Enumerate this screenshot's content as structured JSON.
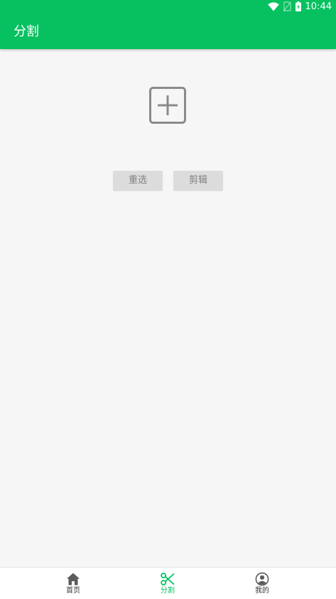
{
  "status_bar": {
    "time": "10:44",
    "icons": [
      "wifi-icon",
      "no-sim-icon",
      "battery-charging-icon"
    ]
  },
  "app_bar": {
    "title": "分割"
  },
  "main": {
    "add_image_icon": "add-square-icon",
    "reselect_label": "重选",
    "crop_label": "剪辑"
  },
  "bottom_nav": {
    "items": [
      {
        "label": "首页",
        "icon": "home-icon",
        "active": false
      },
      {
        "label": "分割",
        "icon": "scissors-icon",
        "active": true
      },
      {
        "label": "我的",
        "icon": "profile-icon",
        "active": false
      }
    ]
  },
  "colors": {
    "primary": "#07c160",
    "background": "#f6f6f6",
    "button_bg": "#dcdcdc",
    "button_text": "#808080",
    "nav_inactive": "#333333",
    "nav_active": "#07c160"
  }
}
